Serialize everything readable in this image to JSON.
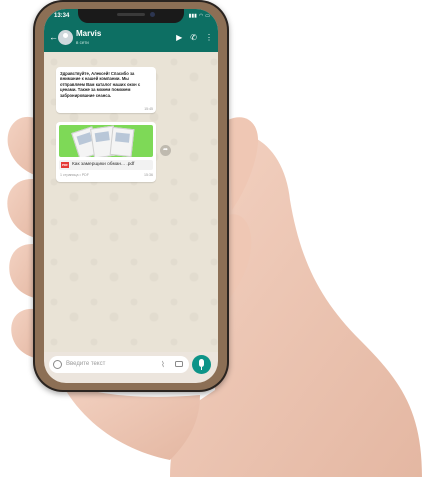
{
  "status_bar": {
    "time": "13:34"
  },
  "chat_header": {
    "contact_name": "Marvis",
    "contact_status": "в сети"
  },
  "messages": [
    {
      "text": "Здравствуйте, Алексей! Спасибо за внимание к нашей компании. Мы отправляем Вам каталог наших окон с ценами. Также за можем поможем забронирование сеанса.",
      "time": "15:45"
    },
    {
      "file_name": "Как замерщики обман... .pdf",
      "file_meta": "1 страница • PDF",
      "file_badge": "PDF",
      "time": "15:36"
    }
  ],
  "input": {
    "placeholder": "Введите текст"
  },
  "colors": {
    "header": "#0d6f63",
    "mic_button": "#0d9488",
    "preview": "#7ed957"
  }
}
